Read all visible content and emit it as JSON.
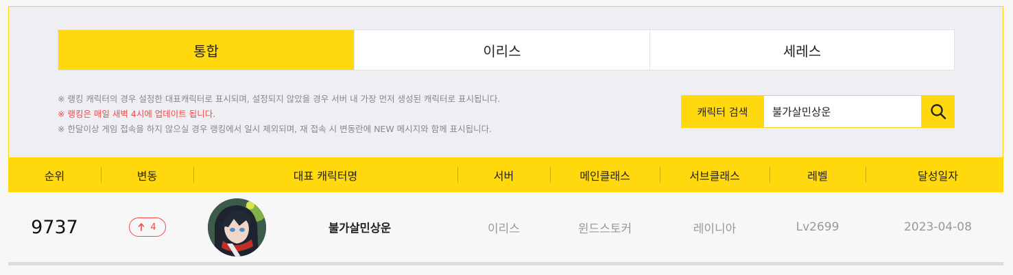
{
  "tabs": [
    {
      "label": "통합",
      "active": true
    },
    {
      "label": "이리스",
      "active": false
    },
    {
      "label": "세레스",
      "active": false
    }
  ],
  "notes": {
    "line1": "※ 랭킹 캐릭터의 경우 설정한 대표캐릭터로 표시되며, 설정되지 않았을 경우 서버 내 가장 먼저 생성된 캐릭터로 표시됩니다.",
    "line2": "※ 랭킹은 매일 새벽 4시에 업데이트 됩니다.",
    "line3": "※ 한달이상 게임 접속을 하지 않으실 경우 랭킹에서 일시 제외되며, 재 접속 시 변동란에 NEW 메시지와 함께 표시됩니다."
  },
  "search": {
    "label": "캐릭터 검색",
    "value": "불가살민상운",
    "button_icon": "search-icon"
  },
  "table": {
    "headers": {
      "rank": "순위",
      "change": "변동",
      "character": "대표 캐릭터명",
      "server": "서버",
      "main_class": "메인클래스",
      "sub_class": "서브클래스",
      "level": "레벨",
      "date": "달성일자"
    },
    "rows": [
      {
        "rank": "9737",
        "change_icon": "arrow-up-icon",
        "change": "4",
        "avatar": "character-avatar",
        "name": "불가살민상운",
        "server": "이리스",
        "main_class": "윈드스토커",
        "sub_class": "레이니아",
        "level": "Lv2699",
        "date": "2023-04-08"
      }
    ]
  },
  "colors": {
    "accent": "#ffd80d",
    "change_up": "#f04848",
    "panel_bg": "#efeef3"
  }
}
